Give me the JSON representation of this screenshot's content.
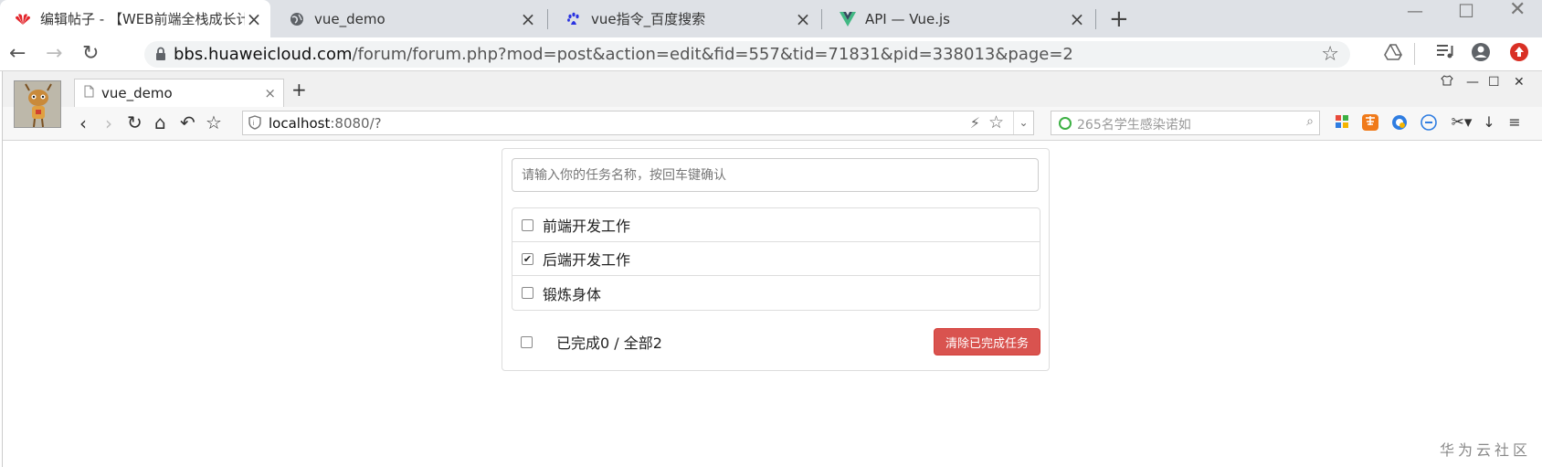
{
  "outer_browser": {
    "tabs": [
      {
        "title": "编辑帖子 - 【WEB前端全栈成长计划",
        "icon": "huawei-logo-icon"
      },
      {
        "title": "vue_demo",
        "icon": "globe-icon"
      },
      {
        "title": "vue指令_百度搜索",
        "icon": "baidu-paw-icon"
      },
      {
        "title": "API — Vue.js",
        "icon": "vue-logo-icon"
      }
    ],
    "close_glyph": "×",
    "new_tab_glyph": "+",
    "url_domain": "bbs.huaweicloud.com",
    "url_path": "/forum/forum.php?mod=post&action=edit&fid=557&tid=71831&pid=338013&page=2"
  },
  "inner_browser": {
    "tab_title": "vue_demo",
    "tab_close_glyph": "×",
    "new_tab_glyph": "+",
    "url_host": "localhost",
    "url_rest": ":8080/?",
    "search_placeholder": "265名学生感染诺如"
  },
  "todo": {
    "input_placeholder": "请输入你的任务名称，按回车键确认",
    "items": [
      {
        "label": "前端开发工作",
        "done": false
      },
      {
        "label": "后端开发工作",
        "done": true
      },
      {
        "label": "锻炼身体",
        "done": false
      }
    ],
    "check_glyph": "✔",
    "status_text": "已完成0 / 全部2",
    "clear_button": "清除已完成任务"
  },
  "watermark": "华为云社区",
  "colors": {
    "accent_danger": "#d9534f",
    "outer_bg": "#dee1e6"
  }
}
